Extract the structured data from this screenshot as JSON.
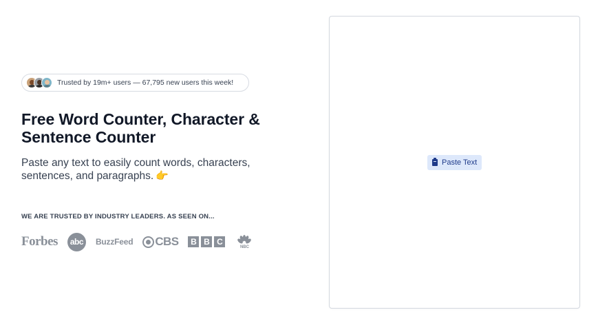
{
  "hero": {
    "trust_text": "Trusted by 19m+ users — 67,795 new users this week!",
    "title": "Free Word Counter, Character & Sentence Counter",
    "subtitle": "Paste any text to easily count words, characters, sentences, and paragraphs.",
    "subtitle_emoji": "👉",
    "leaders_label": "WE ARE TRUSTED BY INDUSTRY LEADERS. AS SEEN ON..."
  },
  "logos": {
    "forbes": "Forbes",
    "abc": "abc",
    "buzzfeed": "BuzzFeed",
    "cbs": "CBS",
    "bbc": [
      "B",
      "B",
      "C"
    ],
    "nbc": "NBC"
  },
  "editor": {
    "paste_label": "Paste Text"
  },
  "colors": {
    "logo_gray": "#8a9099",
    "paste_bg": "#dde8fb",
    "paste_text": "#1e3a8a"
  }
}
